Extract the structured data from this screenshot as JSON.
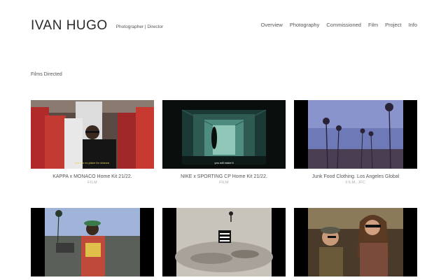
{
  "site": {
    "name": "IVAN HUGO",
    "tagline": "Photographer | Director"
  },
  "nav": [
    {
      "label": "Overview"
    },
    {
      "label": "Photography"
    },
    {
      "label": "Commissioned"
    },
    {
      "label": "Film"
    },
    {
      "label": "Project"
    },
    {
      "label": "Info"
    }
  ],
  "section": {
    "title": "Films Directed"
  },
  "films": [
    {
      "title": "KAPPA x MONACO Home Kit 21/22.",
      "category": "FILM",
      "subtitle_overlay": "there is no place for chance."
    },
    {
      "title": "NIKE x SPORTING CP Home Kit 21/22.",
      "category": "FILM",
      "subtitle_overlay": "you will make it"
    },
    {
      "title": "Junk Food Clothing. Los Angeles Global",
      "category": "FILM, JFC",
      "subtitle_overlay": ""
    },
    {
      "title": "",
      "category": "",
      "subtitle_overlay": ""
    },
    {
      "title": "",
      "category": "",
      "subtitle_overlay": ""
    },
    {
      "title": "",
      "category": "",
      "subtitle_overlay": ""
    }
  ],
  "colors": {
    "text": "#333333",
    "muted": "#aaaaaa",
    "background": "#ffffff"
  }
}
